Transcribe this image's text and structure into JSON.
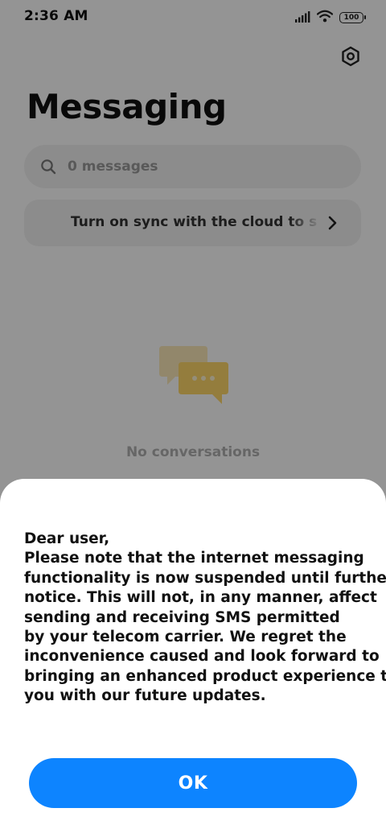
{
  "status_bar": {
    "time": "2:36 AM",
    "battery": "100",
    "icons": [
      "signal-icon",
      "wifi-icon",
      "battery-icon"
    ]
  },
  "header": {
    "title": "Messaging",
    "settings_icon": "settings-icon"
  },
  "search": {
    "placeholder": "0 messages",
    "icon": "search-icon"
  },
  "sync_banner": {
    "text": "Turn on sync with the cloud to s",
    "icon": "chevron-right-icon"
  },
  "empty_state": {
    "icon": "chat-bubbles-icon",
    "text": "No conversations"
  },
  "dialog": {
    "lines": [
      "Dear user,",
      "Please note that the internet messaging",
      "functionality is now suspended until further",
      "notice. This will not, in any manner, affect",
      "sending and receiving SMS permitted",
      "by your telecom carrier. We regret the",
      "inconvenience caused and look forward to",
      "bringing an enhanced product experience to",
      "you with our future updates."
    ],
    "ok_label": "OK"
  },
  "colors": {
    "accent": "#0d84ff",
    "overlay": "#000000",
    "card_bg": "#f2f2f2",
    "illustration": "#ffd76a"
  }
}
